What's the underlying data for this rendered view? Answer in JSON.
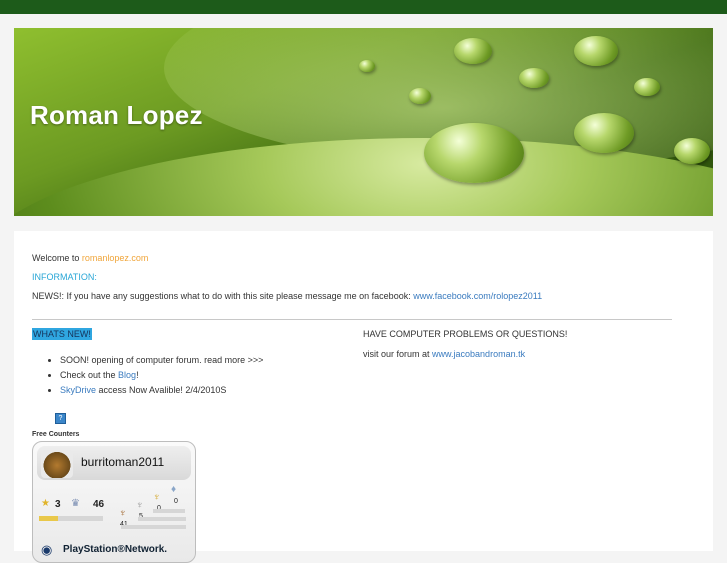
{
  "site": {
    "title": "Roman Lopez"
  },
  "intro": {
    "welcome_text": "Welcome to ",
    "welcome_link": "romanlopez.com",
    "information_label": "INFORMATION:",
    "news_text": "NEWS!: If you have any suggestions what to do with this site please message me on facebook: ",
    "news_link": "www.facebook.com/rolopez2011"
  },
  "whats_new": {
    "label": "WHATS NEW!",
    "items": [
      {
        "before": "SOON! opening of computer forum. read more >>>",
        "link": "",
        "after": ""
      },
      {
        "before": "Check out the ",
        "link": "Blog",
        "after": "!"
      },
      {
        "before": "",
        "link": "SkyDrive",
        "after": " access Now Avalible! 2/4/2010S"
      }
    ]
  },
  "right_column": {
    "heading": "HAVE COMPUTER PROBLEMS OR QUESTIONS!",
    "forum_text": "visit our forum at ",
    "forum_link": "www.jacobandroman.tk"
  },
  "counter": {
    "icon": "?",
    "label": "Free Counters"
  },
  "psn_card": {
    "username": "burritoman2011",
    "level": "3",
    "level_progress": 0.3,
    "trophy_total": "46",
    "platinum": "0",
    "gold": "0",
    "silver": "5",
    "bronze": "41",
    "network_label": "PlayStation®Network."
  },
  "colors": {
    "topbar": "#1d5b1a",
    "link": "#3a7bbf",
    "highlight": "#2fa6e0"
  }
}
